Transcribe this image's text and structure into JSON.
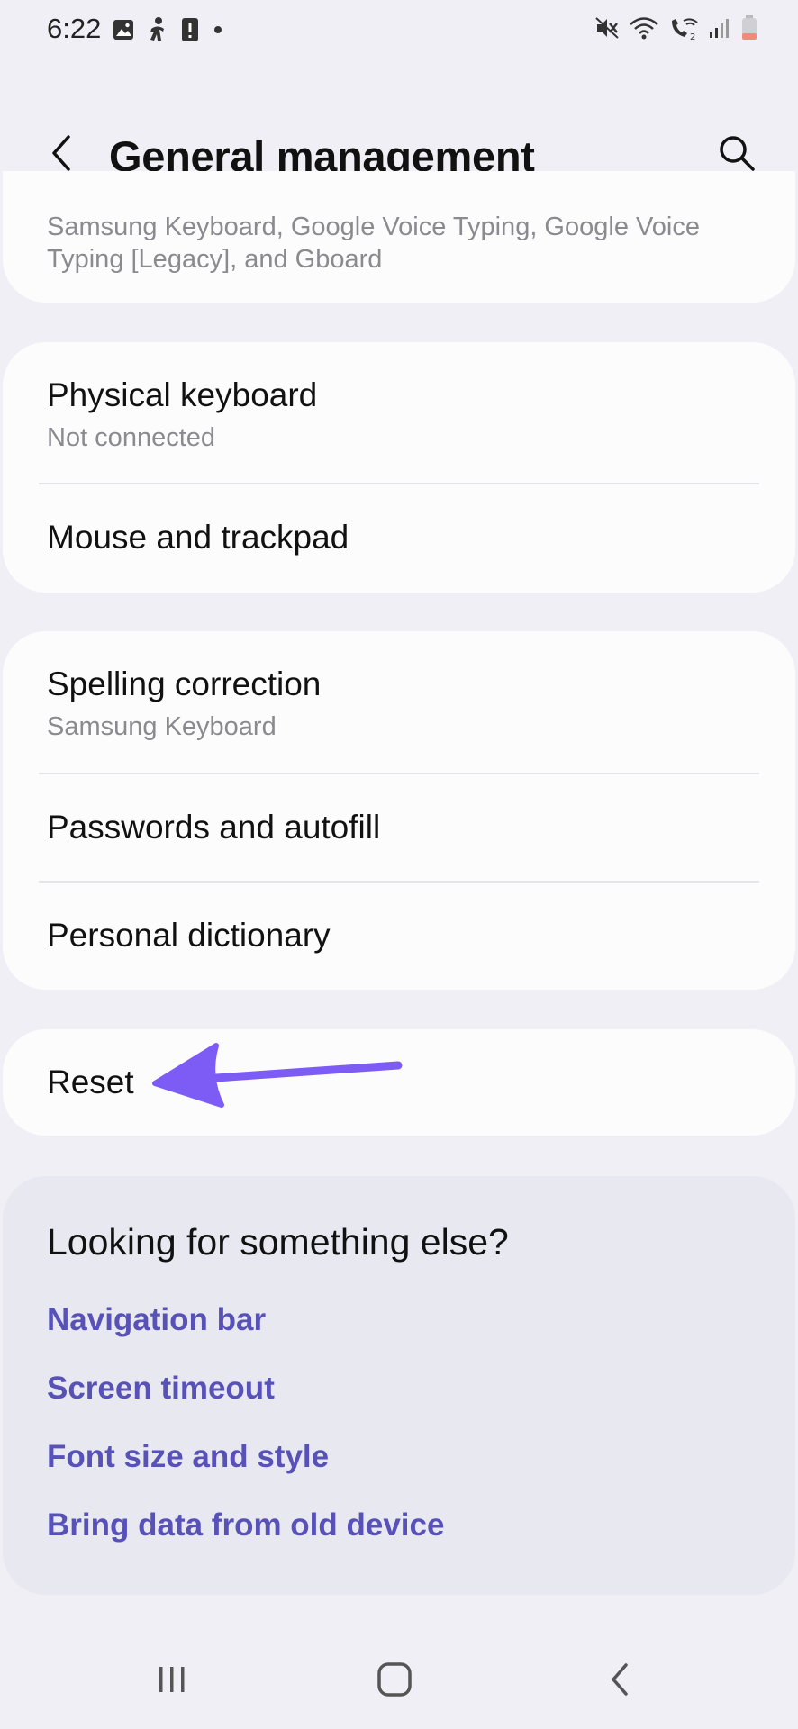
{
  "status_bar": {
    "time": "6:22",
    "left_icons": [
      "gallery-icon",
      "accessibility-icon",
      "alert-icon",
      "dot-icon"
    ],
    "right_icons": [
      "mute-icon",
      "wifi-icon",
      "wifi-call-icon",
      "signal-icon",
      "battery-icon"
    ]
  },
  "header": {
    "title": "General management",
    "back_icon": "chevron-left-icon",
    "search_icon": "search-icon"
  },
  "cards": {
    "partial": {
      "text": "Samsung Keyboard, Google Voice Typing, Google Voice Typing [Legacy], and Gboard"
    },
    "keyboard": {
      "items": [
        {
          "title": "Physical keyboard",
          "subtitle": "Not connected"
        },
        {
          "title": "Mouse and trackpad"
        }
      ]
    },
    "spelling": {
      "items": [
        {
          "title": "Spelling correction",
          "subtitle": "Samsung Keyboard"
        },
        {
          "title": "Passwords and autofill"
        },
        {
          "title": "Personal dictionary"
        }
      ]
    },
    "reset": {
      "title": "Reset"
    }
  },
  "looking": {
    "title": "Looking for something else?",
    "links": [
      "Navigation bar",
      "Screen timeout",
      "Font size and style",
      "Bring data from old device"
    ]
  },
  "colors": {
    "background": "#f0eff5",
    "card": "#fcfcfd",
    "link": "#5751b8",
    "arrow": "#7c5cf5"
  },
  "nav_bar": {
    "icons": [
      "recent-apps-icon",
      "home-icon",
      "back-icon"
    ]
  }
}
